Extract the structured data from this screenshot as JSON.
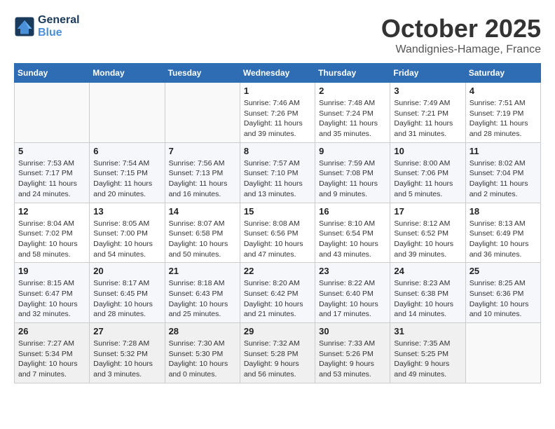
{
  "header": {
    "logo_line1": "General",
    "logo_line2": "Blue",
    "month": "October 2025",
    "location": "Wandignies-Hamage, France"
  },
  "days_of_week": [
    "Sunday",
    "Monday",
    "Tuesday",
    "Wednesday",
    "Thursday",
    "Friday",
    "Saturday"
  ],
  "weeks": [
    [
      {
        "day": "",
        "info": ""
      },
      {
        "day": "",
        "info": ""
      },
      {
        "day": "",
        "info": ""
      },
      {
        "day": "1",
        "info": "Sunrise: 7:46 AM\nSunset: 7:26 PM\nDaylight: 11 hours\nand 39 minutes."
      },
      {
        "day": "2",
        "info": "Sunrise: 7:48 AM\nSunset: 7:24 PM\nDaylight: 11 hours\nand 35 minutes."
      },
      {
        "day": "3",
        "info": "Sunrise: 7:49 AM\nSunset: 7:21 PM\nDaylight: 11 hours\nand 31 minutes."
      },
      {
        "day": "4",
        "info": "Sunrise: 7:51 AM\nSunset: 7:19 PM\nDaylight: 11 hours\nand 28 minutes."
      }
    ],
    [
      {
        "day": "5",
        "info": "Sunrise: 7:53 AM\nSunset: 7:17 PM\nDaylight: 11 hours\nand 24 minutes."
      },
      {
        "day": "6",
        "info": "Sunrise: 7:54 AM\nSunset: 7:15 PM\nDaylight: 11 hours\nand 20 minutes."
      },
      {
        "day": "7",
        "info": "Sunrise: 7:56 AM\nSunset: 7:13 PM\nDaylight: 11 hours\nand 16 minutes."
      },
      {
        "day": "8",
        "info": "Sunrise: 7:57 AM\nSunset: 7:10 PM\nDaylight: 11 hours\nand 13 minutes."
      },
      {
        "day": "9",
        "info": "Sunrise: 7:59 AM\nSunset: 7:08 PM\nDaylight: 11 hours\nand 9 minutes."
      },
      {
        "day": "10",
        "info": "Sunrise: 8:00 AM\nSunset: 7:06 PM\nDaylight: 11 hours\nand 5 minutes."
      },
      {
        "day": "11",
        "info": "Sunrise: 8:02 AM\nSunset: 7:04 PM\nDaylight: 11 hours\nand 2 minutes."
      }
    ],
    [
      {
        "day": "12",
        "info": "Sunrise: 8:04 AM\nSunset: 7:02 PM\nDaylight: 10 hours\nand 58 minutes."
      },
      {
        "day": "13",
        "info": "Sunrise: 8:05 AM\nSunset: 7:00 PM\nDaylight: 10 hours\nand 54 minutes."
      },
      {
        "day": "14",
        "info": "Sunrise: 8:07 AM\nSunset: 6:58 PM\nDaylight: 10 hours\nand 50 minutes."
      },
      {
        "day": "15",
        "info": "Sunrise: 8:08 AM\nSunset: 6:56 PM\nDaylight: 10 hours\nand 47 minutes."
      },
      {
        "day": "16",
        "info": "Sunrise: 8:10 AM\nSunset: 6:54 PM\nDaylight: 10 hours\nand 43 minutes."
      },
      {
        "day": "17",
        "info": "Sunrise: 8:12 AM\nSunset: 6:52 PM\nDaylight: 10 hours\nand 39 minutes."
      },
      {
        "day": "18",
        "info": "Sunrise: 8:13 AM\nSunset: 6:49 PM\nDaylight: 10 hours\nand 36 minutes."
      }
    ],
    [
      {
        "day": "19",
        "info": "Sunrise: 8:15 AM\nSunset: 6:47 PM\nDaylight: 10 hours\nand 32 minutes."
      },
      {
        "day": "20",
        "info": "Sunrise: 8:17 AM\nSunset: 6:45 PM\nDaylight: 10 hours\nand 28 minutes."
      },
      {
        "day": "21",
        "info": "Sunrise: 8:18 AM\nSunset: 6:43 PM\nDaylight: 10 hours\nand 25 minutes."
      },
      {
        "day": "22",
        "info": "Sunrise: 8:20 AM\nSunset: 6:42 PM\nDaylight: 10 hours\nand 21 minutes."
      },
      {
        "day": "23",
        "info": "Sunrise: 8:22 AM\nSunset: 6:40 PM\nDaylight: 10 hours\nand 17 minutes."
      },
      {
        "day": "24",
        "info": "Sunrise: 8:23 AM\nSunset: 6:38 PM\nDaylight: 10 hours\nand 14 minutes."
      },
      {
        "day": "25",
        "info": "Sunrise: 8:25 AM\nSunset: 6:36 PM\nDaylight: 10 hours\nand 10 minutes."
      }
    ],
    [
      {
        "day": "26",
        "info": "Sunrise: 7:27 AM\nSunset: 5:34 PM\nDaylight: 10 hours\nand 7 minutes."
      },
      {
        "day": "27",
        "info": "Sunrise: 7:28 AM\nSunset: 5:32 PM\nDaylight: 10 hours\nand 3 minutes."
      },
      {
        "day": "28",
        "info": "Sunrise: 7:30 AM\nSunset: 5:30 PM\nDaylight: 10 hours\nand 0 minutes."
      },
      {
        "day": "29",
        "info": "Sunrise: 7:32 AM\nSunset: 5:28 PM\nDaylight: 9 hours\nand 56 minutes."
      },
      {
        "day": "30",
        "info": "Sunrise: 7:33 AM\nSunset: 5:26 PM\nDaylight: 9 hours\nand 53 minutes."
      },
      {
        "day": "31",
        "info": "Sunrise: 7:35 AM\nSunset: 5:25 PM\nDaylight: 9 hours\nand 49 minutes."
      },
      {
        "day": "",
        "info": ""
      }
    ]
  ]
}
